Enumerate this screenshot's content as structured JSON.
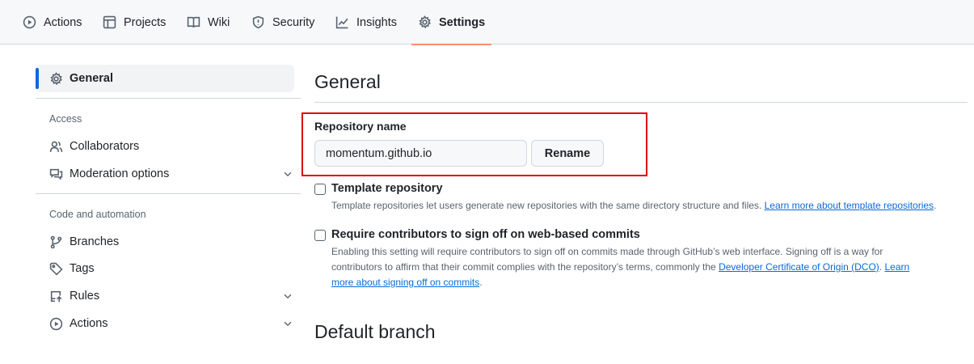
{
  "nav": {
    "tabs": [
      {
        "label": "Actions",
        "icon": "play-circle-icon"
      },
      {
        "label": "Projects",
        "icon": "table-icon"
      },
      {
        "label": "Wiki",
        "icon": "book-icon"
      },
      {
        "label": "Security",
        "icon": "shield-icon"
      },
      {
        "label": "Insights",
        "icon": "graph-icon"
      },
      {
        "label": "Settings",
        "icon": "gear-icon",
        "active": true
      }
    ]
  },
  "sidebar": {
    "active": {
      "label": "General",
      "icon": "gear-icon"
    },
    "groups": [
      {
        "label": "Access",
        "items": [
          {
            "label": "Collaborators",
            "icon": "people-icon"
          },
          {
            "label": "Moderation options",
            "icon": "comment-discussion-icon",
            "expandable": true
          }
        ]
      },
      {
        "label": "Code and automation",
        "items": [
          {
            "label": "Branches",
            "icon": "git-branch-icon"
          },
          {
            "label": "Tags",
            "icon": "tag-icon"
          },
          {
            "label": "Rules",
            "icon": "repo-push-icon",
            "expandable": true
          },
          {
            "label": "Actions",
            "icon": "play-circle-icon",
            "expandable": true
          }
        ]
      }
    ]
  },
  "main": {
    "title": "General",
    "repo_name": {
      "label": "Repository name",
      "value": "momentum.github.io",
      "rename_label": "Rename"
    },
    "template": {
      "title": "Template repository",
      "desc": "Template repositories let users generate new repositories with the same directory structure and files. ",
      "link": "Learn more about template repositories",
      "after": "."
    },
    "signoff": {
      "title": "Require contributors to sign off on web-based commits",
      "line1": "Enabling this setting will require contributors to sign off on commits made through GitHub’s web interface. Signing off is a way for",
      "line2": "contributors to affirm that their commit complies with the repository’s terms, commonly the ",
      "link1": "Developer Certificate of Origin (DCO)",
      "mid": ". ",
      "link2a": "Learn",
      "link2b": "more about signing off on commits",
      "after": "."
    },
    "default_branch_title": "Default branch"
  },
  "colors": {
    "accent": "#0969da",
    "tab_underline": "#fd8c73",
    "highlight_box": "#e00000"
  }
}
